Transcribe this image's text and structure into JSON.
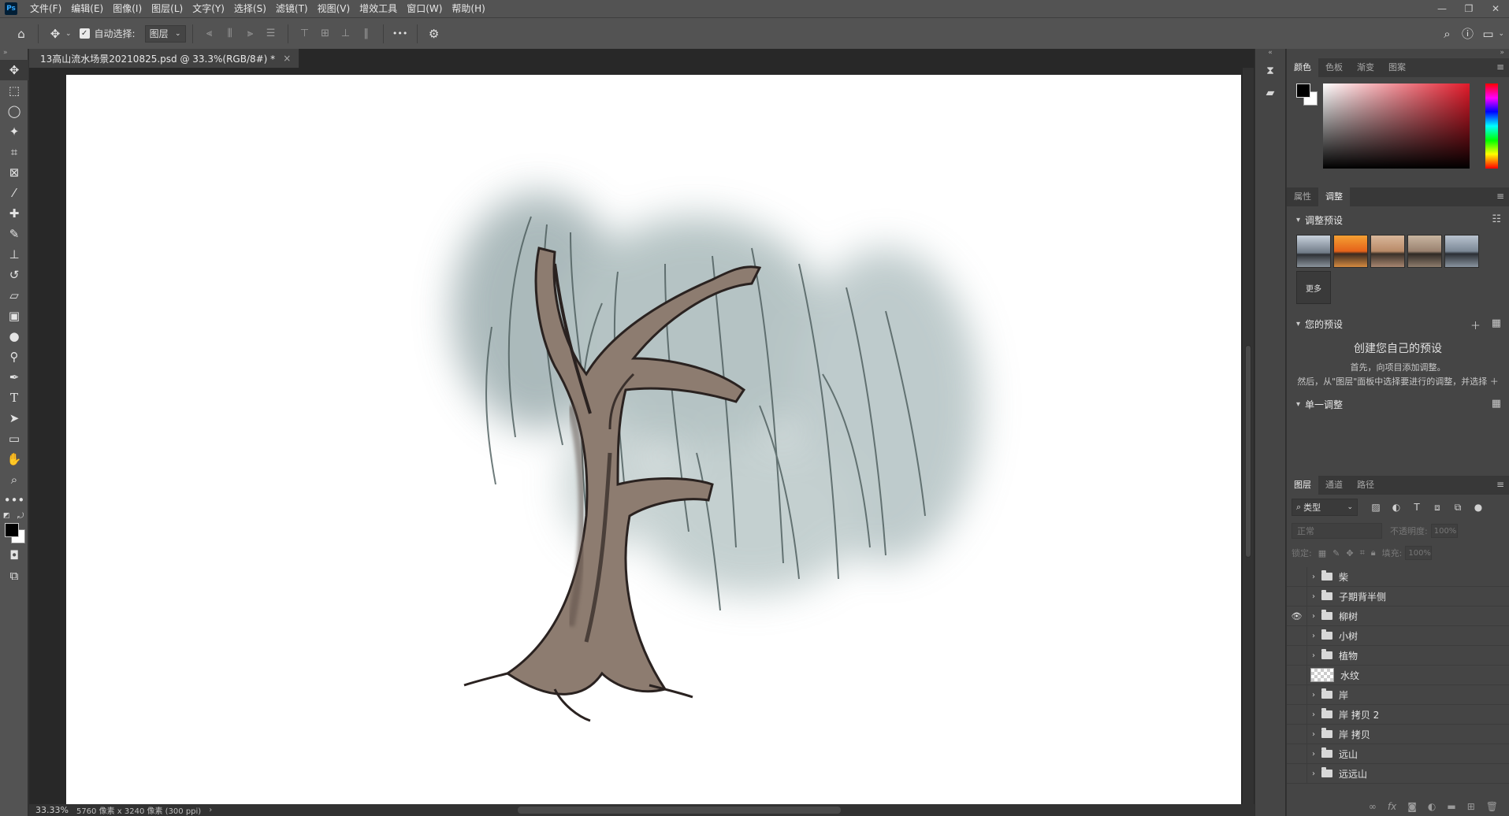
{
  "app": {
    "logo": "Ps"
  },
  "menu": [
    "文件(F)",
    "编辑(E)",
    "图像(I)",
    "图层(L)",
    "文字(Y)",
    "选择(S)",
    "滤镜(T)",
    "视图(V)",
    "增效工具",
    "窗口(W)",
    "帮助(H)"
  ],
  "window_controls": {
    "minimize": "—",
    "restore": "❐",
    "close": "✕"
  },
  "options": {
    "auto_select_label": "自动选择:",
    "auto_select_checked": "✓",
    "target_value": "图层",
    "more": "•••"
  },
  "document": {
    "tab_title": "13高山流水场景20210825.psd @ 33.3%(RGB/8#) *",
    "close": "×"
  },
  "status": {
    "zoom": "33.33%",
    "info": "5760 像素 x 3240 像素 (300 ppi)"
  },
  "color_panel": {
    "tabs": [
      "颜色",
      "色板",
      "渐变",
      "图案"
    ]
  },
  "adjust_panel": {
    "tabs": [
      "属性",
      "调整"
    ],
    "presets_title": "调整预设",
    "more_label": "更多",
    "your_presets_title": "您的预设",
    "create_title": "创建您自己的预设",
    "create_line1": "首先，向项目添加调整。",
    "create_line2": "然后，从\"图层\"面板中选择要进行的调整，并选择 ＋",
    "single_adjust_title": "单一调整"
  },
  "layers_panel": {
    "tabs": [
      "图层",
      "通道",
      "路径"
    ],
    "filter_label": "类型",
    "blend_mode": "正常",
    "opacity_label": "不透明度:",
    "opacity_value": "100%",
    "lock_label": "锁定:",
    "fill_label": "填充:",
    "fill_value": "100%",
    "layers": [
      {
        "name": "柴",
        "type": "group",
        "visible": false
      },
      {
        "name": "子期背半侧",
        "type": "group",
        "visible": false
      },
      {
        "name": "柳树",
        "type": "group",
        "visible": true
      },
      {
        "name": "小树",
        "type": "group",
        "visible": false
      },
      {
        "name": "植物",
        "type": "group",
        "visible": false
      },
      {
        "name": "水纹",
        "type": "layer",
        "visible": false
      },
      {
        "name": "岸",
        "type": "group",
        "visible": false
      },
      {
        "name": "岸 拷贝 2",
        "type": "group",
        "visible": false
      },
      {
        "name": "岸 拷贝",
        "type": "group",
        "visible": false
      },
      {
        "name": "远山",
        "type": "group",
        "visible": false
      },
      {
        "name": "远远山",
        "type": "group",
        "visible": false
      }
    ]
  },
  "colors": {
    "accent": "#31a8ff",
    "canvas": "#ffffff",
    "ui_bg": "#535353"
  }
}
